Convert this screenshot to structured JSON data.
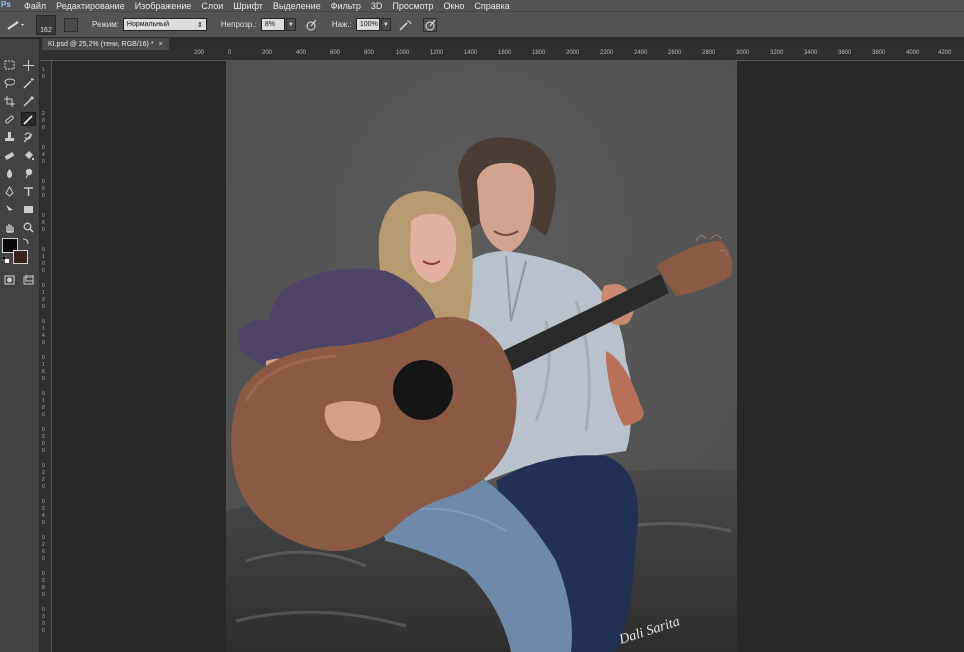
{
  "app": {
    "logo": "Ps"
  },
  "menu": [
    "Файл",
    "Редактирование",
    "Изображение",
    "Слои",
    "Шрифт",
    "Выделение",
    "Фильтр",
    "3D",
    "Просмотр",
    "Окно",
    "Справка"
  ],
  "options": {
    "brush_size": "162",
    "mode_label": "Режим:",
    "mode_value": "Нормальный",
    "opacity_label": "Непрозр.:",
    "opacity_value": "8%",
    "flow_label": "Наж.:",
    "flow_value": "100%"
  },
  "document": {
    "tab_title": "KI.psd @ 25,2% (тени, RGB/16) *",
    "close": "×"
  },
  "ruler": {
    "top_labels": [
      "200",
      "0",
      "200",
      "400",
      "600",
      "800",
      "1000",
      "1200",
      "1400",
      "1600",
      "1800",
      "2000",
      "2200",
      "2400",
      "2600",
      "2800",
      "3000",
      "3200",
      "3400",
      "3600",
      "3800",
      "4000",
      "4200"
    ],
    "left_labels": [
      "1",
      "0",
      "2",
      "0",
      "0",
      "0",
      "4",
      "0",
      "0",
      "6",
      "0",
      "0",
      "8",
      "0",
      "0",
      "1",
      "0",
      "0",
      "0",
      "1",
      "2",
      "0",
      "0",
      "1",
      "4",
      "0",
      "0",
      "1",
      "6",
      "0",
      "0",
      "1",
      "8",
      "0",
      "0",
      "2",
      "0",
      "0",
      "0",
      "2",
      "2",
      "0",
      "0",
      "2",
      "4",
      "0",
      "0",
      "2",
      "6",
      "0",
      "0",
      "2",
      "8",
      "0",
      "0",
      "3",
      "0",
      "0",
      "0"
    ]
  },
  "artwork": {
    "signature": "Dali Sarita",
    "colors": {
      "background": "#575757",
      "guitar_body": "#8b5a45",
      "guitar_neck": "#2a2a2a",
      "jeans": "#6f8aa8",
      "dark_jeans": "#223054",
      "shirt": "#b9c2cc",
      "sweater": "#4e4466",
      "skin": "#d4a08a",
      "hair_girl": "#b89a70",
      "hair_man": "#4b3c35"
    }
  }
}
